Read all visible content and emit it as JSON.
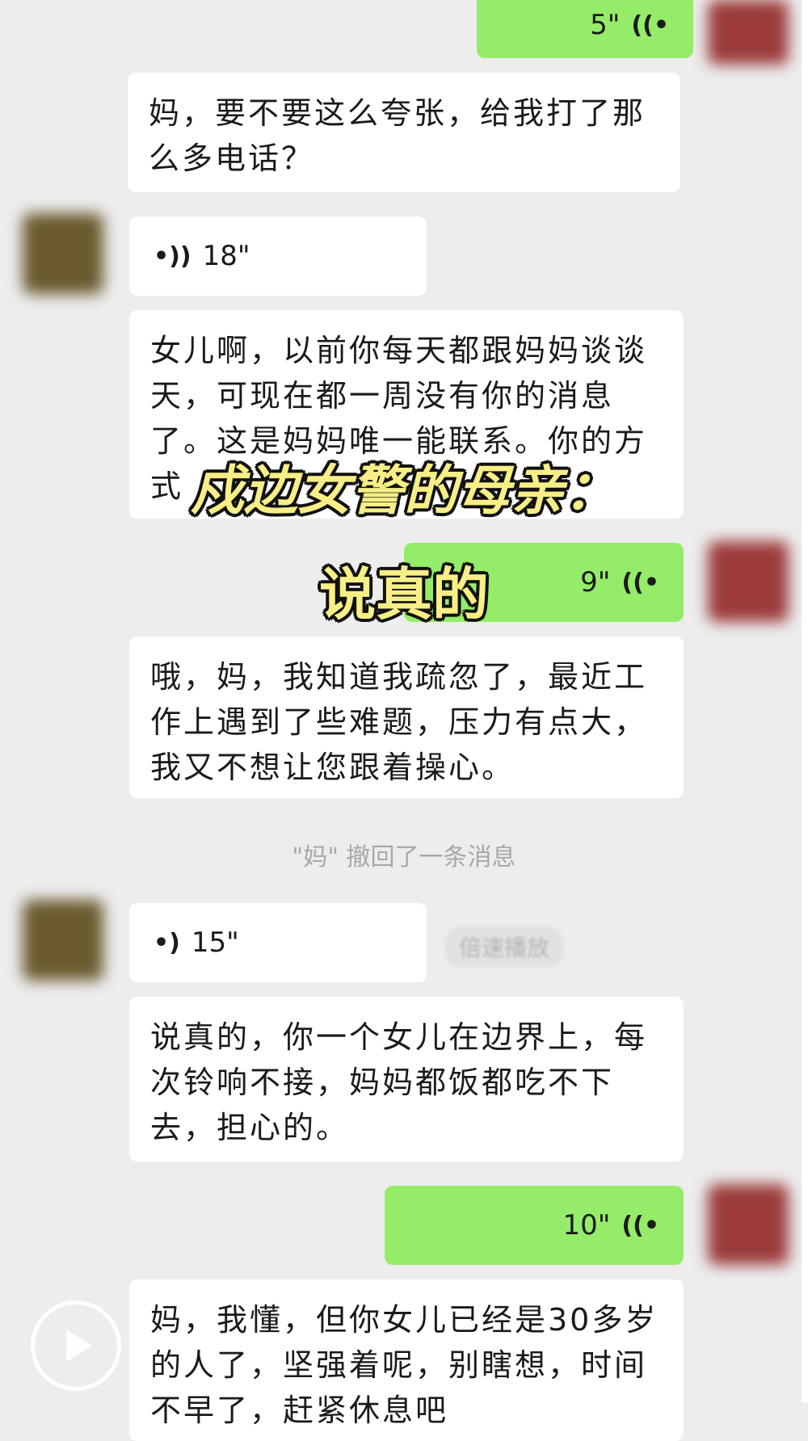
{
  "messages": [
    {
      "kind": "voice",
      "from": "me",
      "duration": "5\""
    },
    {
      "kind": "text",
      "from": "me",
      "text": "妈，要不要这么夸张，给我打了那么多电话？"
    },
    {
      "kind": "voice",
      "from": "mom",
      "duration": "18\""
    },
    {
      "kind": "text",
      "from": "mom",
      "text": "女儿啊，以前你每天都跟妈妈谈谈天，可现在都一周没有你的消息了。这是妈妈唯一能联系。你的方式"
    },
    {
      "kind": "voice",
      "from": "me",
      "duration": "9\""
    },
    {
      "kind": "text",
      "from": "me",
      "text": "哦，妈，我知道我疏忽了，最近工作上遇到了些难题，压力有点大，我又不想让您跟着操心。"
    },
    {
      "kind": "system",
      "text": "\"妈\" 撤回了一条消息"
    },
    {
      "kind": "voice",
      "from": "mom",
      "duration": "15\"",
      "tag": "倍速播放"
    },
    {
      "kind": "text",
      "from": "mom",
      "text": "说真的，你一个女儿在边界上，每次铃响不接，妈妈都饭都吃不下去，担心的。"
    },
    {
      "kind": "voice",
      "from": "me",
      "duration": "10\""
    },
    {
      "kind": "text",
      "from": "me",
      "text": "妈，我懂，但你女儿已经是30多岁的人了，坚强着呢，别瞎想，时间不早了，赶紧休息吧"
    }
  ],
  "captions": {
    "line1": "戍边女警的母亲：",
    "line2": "说真的"
  },
  "icons": {
    "voice_incoming": "speaker-wave-icon",
    "voice_outgoing": "speaker-wave-icon",
    "play": "play-icon"
  },
  "colors": {
    "background": "#ededed",
    "incoming_bubble": "#ffffff",
    "outgoing_bubble": "#95ec69",
    "caption_fill": "#f7ef86"
  }
}
